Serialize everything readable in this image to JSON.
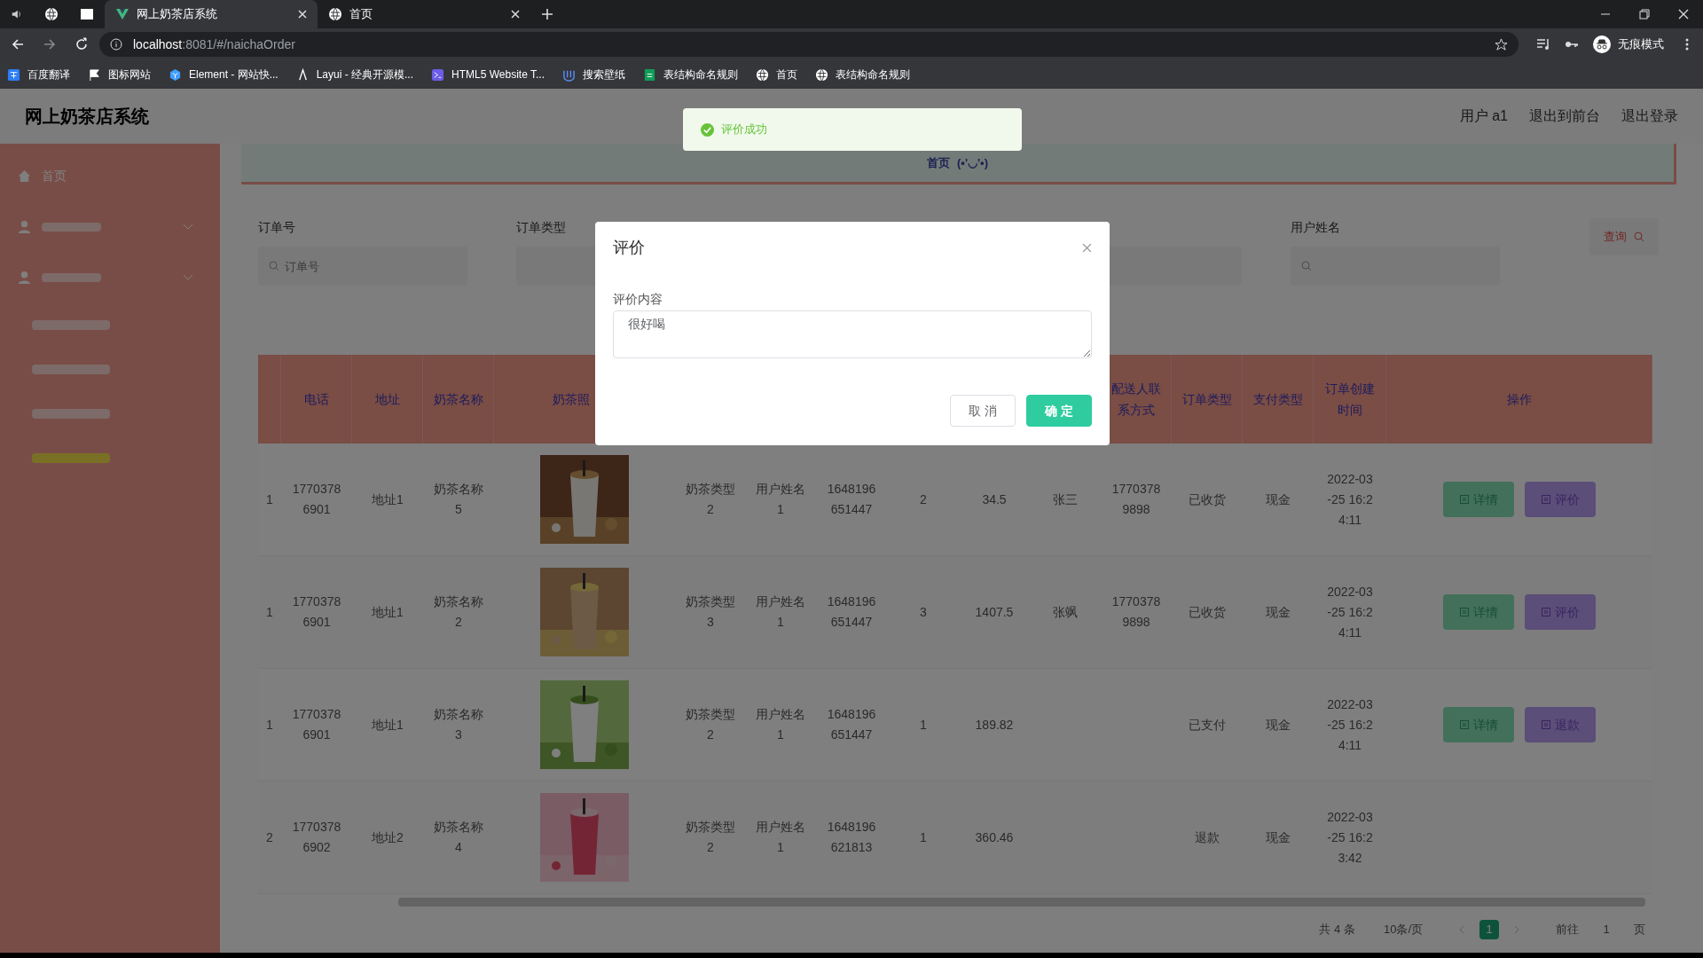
{
  "browser": {
    "tabs": [
      {
        "title": "网上奶茶店系统",
        "selected": true
      },
      {
        "title": "首页",
        "selected": false
      }
    ],
    "address": {
      "host": "localhost",
      "rest": ":8081/#/naichaOrder"
    },
    "bookmarks": [
      {
        "label": "百度翻译"
      },
      {
        "label": "图标网站"
      },
      {
        "label": "Element - 网站快..."
      },
      {
        "label": "Layui - 经典开源模..."
      },
      {
        "label": "HTML5 Website T..."
      },
      {
        "label": "搜索壁纸"
      },
      {
        "label": "表结构命名规则"
      },
      {
        "label": "首页"
      },
      {
        "label": "表结构命名规则"
      }
    ],
    "profile": "无痕模式"
  },
  "app": {
    "title": "网上奶茶店系统",
    "header_links": [
      "用户 a1",
      "退出到前台",
      "退出登录"
    ],
    "sidebar": {
      "items": [
        {
          "kind": "link",
          "label": "首页",
          "selected": false
        },
        {
          "kind": "group",
          "selected": false
        },
        {
          "kind": "group",
          "selected": false
        },
        {
          "kind": "sub",
          "selected": false
        },
        {
          "kind": "sub",
          "selected": false
        },
        {
          "kind": "sub",
          "selected": false
        },
        {
          "kind": "sub",
          "selected": true
        }
      ]
    },
    "breadcrumb": [
      "首页",
      "(•'◡'•)"
    ],
    "search": {
      "fields": [
        {
          "label": "订单号",
          "placeholder": "订单号",
          "kind": "input"
        },
        {
          "label": "订单类型",
          "kind": "select"
        },
        {
          "kind": "select"
        },
        {
          "label": "用户姓名",
          "kind": "input"
        }
      ],
      "button": "查询"
    },
    "table": {
      "columns": [
        null,
        "电话",
        "地址",
        "奶茶名称",
        "奶茶照",
        null,
        null,
        null,
        null,
        null,
        null,
        "配送人联系方式",
        "订单类型",
        "支付类型",
        "订单创建时间",
        "操作"
      ],
      "rows": [
        {
          "cells": [
            "1",
            "17703786901",
            "地址1",
            "奶茶名称5",
            null,
            "奶茶类型2",
            "用户姓名1",
            "1648196651447",
            "2",
            "34.5",
            "张三",
            "17703789898",
            "已收货",
            "现金",
            "2022-03-25 16:24:11"
          ],
          "actions": [
            {
              "label": "详情",
              "kind": "detail"
            },
            {
              "label": "评价",
              "kind": "review"
            }
          ]
        },
        {
          "cells": [
            "1",
            "17703786901",
            "地址1",
            "奶茶名称2",
            null,
            "奶茶类型3",
            "用户姓名1",
            "1648196651447",
            "3",
            "1407.5",
            "张飒",
            "17703789898",
            "已收货",
            "现金",
            "2022-03-25 16:24:11"
          ],
          "actions": [
            {
              "label": "详情",
              "kind": "detail"
            },
            {
              "label": "评价",
              "kind": "review"
            }
          ]
        },
        {
          "cells": [
            "1",
            "17703786901",
            "地址1",
            "奶茶名称3",
            null,
            "奶茶类型2",
            "用户姓名1",
            "1648196651447",
            "1",
            "189.82",
            null,
            null,
            "已支付",
            "现金",
            "2022-03-25 16:24:11"
          ],
          "actions": [
            {
              "label": "详情",
              "kind": "detail"
            },
            {
              "label": "退款",
              "kind": "refund"
            }
          ]
        },
        {
          "cells": [
            "2",
            "17703786902",
            "地址2",
            "奶茶名称4",
            null,
            "奶茶类型2",
            "用户姓名1",
            "1648196621813",
            "1",
            "360.46",
            null,
            null,
            "退款",
            "现金",
            "2022-03-25 16:23:42"
          ],
          "actions": []
        }
      ]
    },
    "pagination": {
      "total": "共 4 条",
      "page_size": "10条/页",
      "pages": [
        {
          "label": "1",
          "selected": true
        }
      ],
      "goto": "前往",
      "goto_value": "1",
      "suffix": "页"
    }
  },
  "toast": {
    "text": "评价成功"
  },
  "dialog": {
    "title": "评价",
    "field_label": "评价内容",
    "value": "很好喝",
    "buttons": [
      {
        "label": "取 消",
        "kind": "cancel"
      },
      {
        "label": "确 定",
        "kind": "confirm"
      }
    ]
  }
}
